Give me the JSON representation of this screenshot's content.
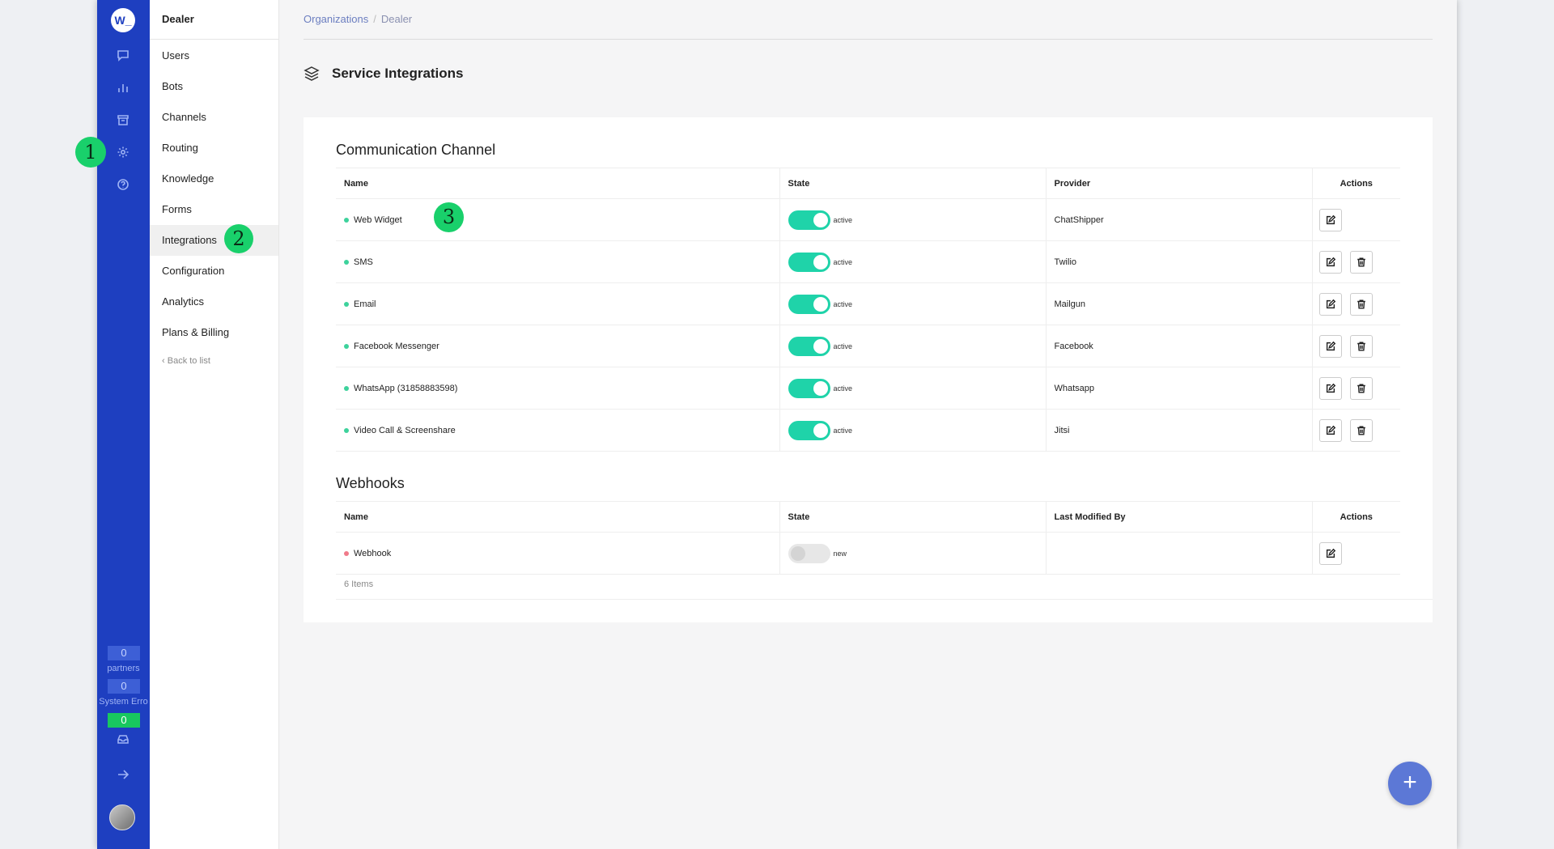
{
  "rail": {
    "logo": "W_",
    "counters": [
      {
        "value": "0",
        "label": "partners"
      },
      {
        "value": "0",
        "label": "System Erro"
      },
      {
        "value": "0",
        "label": ""
      }
    ]
  },
  "badges": [
    "1",
    "2",
    "3"
  ],
  "subnav": {
    "title": "Dealer",
    "items": [
      "Users",
      "Bots",
      "Channels",
      "Routing",
      "Knowledge",
      "Forms",
      "Integrations",
      "Configuration",
      "Analytics",
      "Plans & Billing"
    ],
    "back": "Back to list"
  },
  "breadcrumb": {
    "root": "Organizations",
    "sep": "/",
    "current": "Dealer"
  },
  "page": {
    "title": "Service Integrations"
  },
  "communication": {
    "title": "Communication Channel",
    "headers": {
      "name": "Name",
      "state": "State",
      "provider": "Provider",
      "actions": "Actions"
    },
    "rows": [
      {
        "name": "Web Widget",
        "state": "active",
        "provider": "ChatShipper"
      },
      {
        "name": "SMS",
        "state": "active",
        "provider": "Twilio"
      },
      {
        "name": "Email",
        "state": "active",
        "provider": "Mailgun"
      },
      {
        "name": "Facebook Messenger",
        "state": "active",
        "provider": "Facebook"
      },
      {
        "name": "WhatsApp (31858883598)",
        "state": "active",
        "provider": "Whatsapp"
      },
      {
        "name": "Video Call & Screenshare",
        "state": "active",
        "provider": "Jitsi"
      }
    ]
  },
  "webhooks": {
    "title": "Webhooks",
    "headers": {
      "name": "Name",
      "state": "State",
      "modified": "Last Modified By",
      "actions": "Actions"
    },
    "rows": [
      {
        "name": "Webhook",
        "state": "new",
        "modified": ""
      }
    ]
  },
  "footer": {
    "items": "6 Items"
  },
  "fab": {
    "label": "+"
  },
  "colors": {
    "rail": "#1e3fc0",
    "toggle_on": "#1fd3a9",
    "badge": "#19d06b",
    "fab": "#5c78d6"
  }
}
